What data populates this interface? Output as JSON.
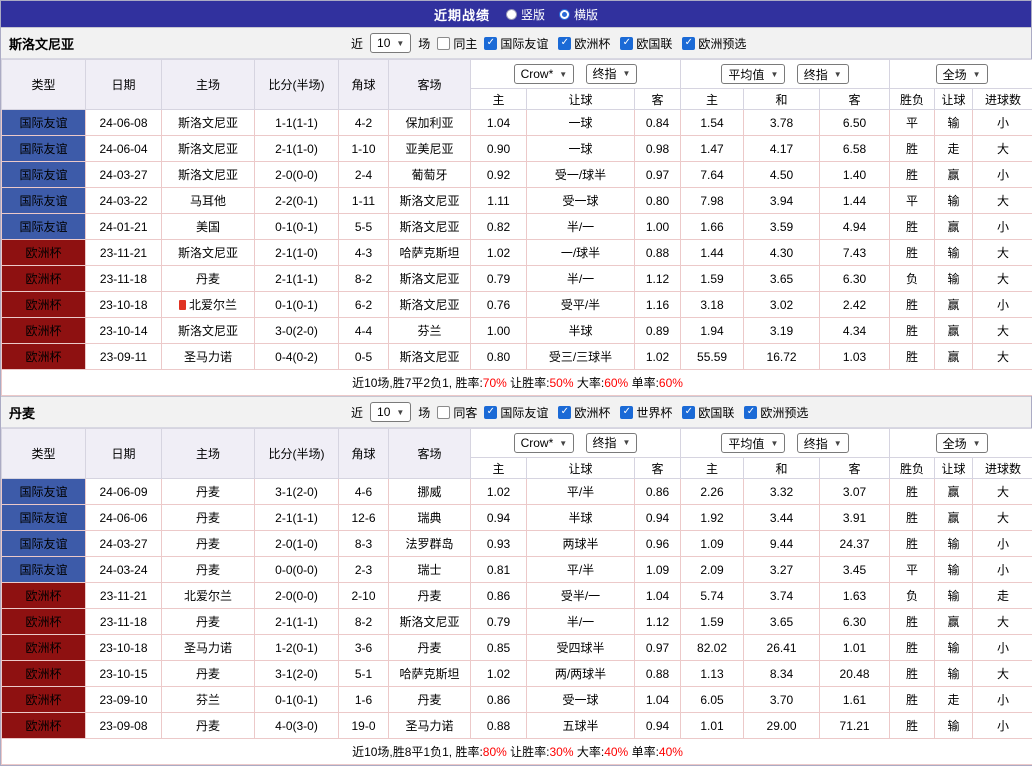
{
  "colors": {
    "topbar_bg": "#31319e",
    "type_blue": "#3d5ba9",
    "type_maroon": "#8e1111",
    "team_green": "#008000",
    "score_red": "#ff0000",
    "win_red": "#ff0000",
    "lose_green": "#008000",
    "loss_blue": "#0000cc",
    "grid_pink": "#ecc9c9",
    "checkbox_blue": "#1b6ad6"
  },
  "top_bar": {
    "title": "近期战绩",
    "radio_options": [
      {
        "label": "竖版",
        "selected": false
      },
      {
        "label": "横版",
        "selected": true
      }
    ]
  },
  "labels": {
    "near": "近",
    "games": "场"
  },
  "table_header": {
    "type": "类型",
    "date": "日期",
    "home": "主场",
    "score": "比分(半场)",
    "corners": "角球",
    "away": "客场",
    "odds_group1": {
      "select_a": "Crow*",
      "select_b": "终指",
      "sub": [
        "主",
        "让球",
        "客"
      ]
    },
    "odds_group2": {
      "select_a": "平均值",
      "select_b": "终指",
      "sub": [
        "主",
        "和",
        "客"
      ]
    },
    "result_group": {
      "select": "全场",
      "sub": [
        "胜负",
        "让球",
        "进球数"
      ]
    }
  },
  "sections": [
    {
      "team": "斯洛文尼亚",
      "filter": {
        "count": "10",
        "same_side_label": "同主",
        "same_side_checked": false,
        "competitions": [
          {
            "label": "国际友谊",
            "checked": true
          },
          {
            "label": "欧洲杯",
            "checked": true
          },
          {
            "label": "欧国联",
            "checked": true
          },
          {
            "label": "欧洲预选",
            "checked": true
          }
        ]
      },
      "rows": [
        {
          "type": "国际友谊",
          "type_color": "blue",
          "date": "24-06-08",
          "home": "斯洛文尼亚",
          "home_green": true,
          "home_icon": false,
          "score": "1-1(1-1)",
          "corners": "4-2",
          "away": "保加利亚",
          "away_green": false,
          "odds1": [
            "1.04",
            "一球",
            "0.84"
          ],
          "odds2": [
            "1.54",
            "3.78",
            "6.50"
          ],
          "result": [
            {
              "text": "平",
              "color": "green"
            },
            {
              "text": "输",
              "color": "green"
            },
            {
              "text": "小",
              "color": "green"
            }
          ]
        },
        {
          "type": "国际友谊",
          "type_color": "blue",
          "date": "24-06-04",
          "home": "斯洛文尼亚",
          "home_green": true,
          "home_icon": false,
          "score": "2-1(1-0)",
          "corners": "1-10",
          "away": "亚美尼亚",
          "away_green": false,
          "odds1": [
            "0.90",
            "一球",
            "0.98"
          ],
          "odds2": [
            "1.47",
            "4.17",
            "6.58"
          ],
          "result": [
            {
              "text": "胜",
              "color": "red"
            },
            {
              "text": "走",
              "color": "green"
            },
            {
              "text": "大",
              "color": "red"
            }
          ]
        },
        {
          "type": "国际友谊",
          "type_color": "blue",
          "date": "24-03-27",
          "home": "斯洛文尼亚",
          "home_green": true,
          "home_icon": false,
          "score": "2-0(0-0)",
          "corners": "2-4",
          "away": "葡萄牙",
          "away_green": false,
          "odds1": [
            "0.92",
            "受一/球半",
            "0.97"
          ],
          "odds2": [
            "7.64",
            "4.50",
            "1.40"
          ],
          "result": [
            {
              "text": "胜",
              "color": "red"
            },
            {
              "text": "赢",
              "color": "red"
            },
            {
              "text": "小",
              "color": "green"
            }
          ]
        },
        {
          "type": "国际友谊",
          "type_color": "blue",
          "date": "24-03-22",
          "home": "马耳他",
          "home_green": false,
          "home_icon": false,
          "score": "2-2(0-1)",
          "corners": "1-11",
          "away": "斯洛文尼亚",
          "away_green": true,
          "odds1": [
            "1.11",
            "受一球",
            "0.80"
          ],
          "odds2": [
            "7.98",
            "3.94",
            "1.44"
          ],
          "result": [
            {
              "text": "平",
              "color": "green"
            },
            {
              "text": "输",
              "color": "green"
            },
            {
              "text": "大",
              "color": "red"
            }
          ]
        },
        {
          "type": "国际友谊",
          "type_color": "blue",
          "date": "24-01-21",
          "home": "美国",
          "home_green": false,
          "home_icon": false,
          "score": "0-1(0-1)",
          "corners": "5-5",
          "away": "斯洛文尼亚",
          "away_green": true,
          "odds1": [
            "0.82",
            "半/一",
            "1.00"
          ],
          "odds2": [
            "1.66",
            "3.59",
            "4.94"
          ],
          "result": [
            {
              "text": "胜",
              "color": "red"
            },
            {
              "text": "赢",
              "color": "red"
            },
            {
              "text": "小",
              "color": "green"
            }
          ]
        },
        {
          "type": "欧洲杯",
          "type_color": "maroon",
          "date": "23-11-21",
          "home": "斯洛文尼亚",
          "home_green": true,
          "home_icon": false,
          "score": "2-1(1-0)",
          "corners": "4-3",
          "away": "哈萨克斯坦",
          "away_green": false,
          "odds1": [
            "1.02",
            "一/球半",
            "0.88"
          ],
          "odds2": [
            "1.44",
            "4.30",
            "7.43"
          ],
          "result": [
            {
              "text": "胜",
              "color": "red"
            },
            {
              "text": "输",
              "color": "green"
            },
            {
              "text": "大",
              "color": "red"
            }
          ]
        },
        {
          "type": "欧洲杯",
          "type_color": "maroon",
          "date": "23-11-18",
          "home": "丹麦",
          "home_green": false,
          "home_icon": false,
          "score": "2-1(1-1)",
          "corners": "8-2",
          "away": "斯洛文尼亚",
          "away_green": true,
          "odds1": [
            "0.79",
            "半/一",
            "1.12"
          ],
          "odds2": [
            "1.59",
            "3.65",
            "6.30"
          ],
          "result": [
            {
              "text": "负",
              "color": "blue"
            },
            {
              "text": "输",
              "color": "green"
            },
            {
              "text": "大",
              "color": "red"
            }
          ]
        },
        {
          "type": "欧洲杯",
          "type_color": "maroon",
          "date": "23-10-18",
          "home": "北爱尔兰",
          "home_green": false,
          "home_icon": true,
          "score": "0-1(0-1)",
          "corners": "6-2",
          "away": "斯洛文尼亚",
          "away_green": true,
          "odds1": [
            "0.76",
            "受平/半",
            "1.16"
          ],
          "odds2": [
            "3.18",
            "3.02",
            "2.42"
          ],
          "result": [
            {
              "text": "胜",
              "color": "red"
            },
            {
              "text": "赢",
              "color": "red"
            },
            {
              "text": "小",
              "color": "green"
            }
          ]
        },
        {
          "type": "欧洲杯",
          "type_color": "maroon",
          "date": "23-10-14",
          "home": "斯洛文尼亚",
          "home_green": true,
          "home_icon": false,
          "score": "3-0(2-0)",
          "corners": "4-4",
          "away": "芬兰",
          "away_green": false,
          "odds1": [
            "1.00",
            "半球",
            "0.89"
          ],
          "odds2": [
            "1.94",
            "3.19",
            "4.34"
          ],
          "result": [
            {
              "text": "胜",
              "color": "red"
            },
            {
              "text": "赢",
              "color": "red"
            },
            {
              "text": "大",
              "color": "red"
            }
          ]
        },
        {
          "type": "欧洲杯",
          "type_color": "maroon",
          "date": "23-09-11",
          "home": "圣马力诺",
          "home_green": false,
          "home_icon": false,
          "score": "0-4(0-2)",
          "corners": "0-5",
          "away": "斯洛文尼亚",
          "away_green": true,
          "odds1": [
            "0.80",
            "受三/三球半",
            "1.02"
          ],
          "odds2": [
            "55.59",
            "16.72",
            "1.03"
          ],
          "result": [
            {
              "text": "胜",
              "color": "red"
            },
            {
              "text": "赢",
              "color": "red"
            },
            {
              "text": "大",
              "color": "red"
            }
          ]
        }
      ],
      "summary": [
        {
          "text": "近10场,胜7平2负1, ",
          "red": false
        },
        {
          "text": "胜率:",
          "red": false
        },
        {
          "text": "70%",
          "red": true
        },
        {
          "text": " 让胜率:",
          "red": false
        },
        {
          "text": "50%",
          "red": true
        },
        {
          "text": " 大率:",
          "red": false
        },
        {
          "text": "60%",
          "red": true
        },
        {
          "text": " 单率:",
          "red": false
        },
        {
          "text": "60%",
          "red": true
        }
      ]
    },
    {
      "team": "丹麦",
      "filter": {
        "count": "10",
        "same_side_label": "同客",
        "same_side_checked": false,
        "competitions": [
          {
            "label": "国际友谊",
            "checked": true
          },
          {
            "label": "欧洲杯",
            "checked": true
          },
          {
            "label": "世界杯",
            "checked": true
          },
          {
            "label": "欧国联",
            "checked": true
          },
          {
            "label": "欧洲预选",
            "checked": true
          }
        ]
      },
      "rows": [
        {
          "type": "国际友谊",
          "type_color": "blue",
          "date": "24-06-09",
          "home": "丹麦",
          "home_green": true,
          "home_icon": false,
          "score": "3-1(2-0)",
          "corners": "4-6",
          "away": "挪威",
          "away_green": false,
          "odds1": [
            "1.02",
            "平/半",
            "0.86"
          ],
          "odds2": [
            "2.26",
            "3.32",
            "3.07"
          ],
          "result": [
            {
              "text": "胜",
              "color": "red"
            },
            {
              "text": "赢",
              "color": "red"
            },
            {
              "text": "大",
              "color": "red"
            }
          ]
        },
        {
          "type": "国际友谊",
          "type_color": "blue",
          "date": "24-06-06",
          "home": "丹麦",
          "home_green": true,
          "home_icon": false,
          "score": "2-1(1-1)",
          "corners": "12-6",
          "away": "瑞典",
          "away_green": false,
          "odds1": [
            "0.94",
            "半球",
            "0.94"
          ],
          "odds2": [
            "1.92",
            "3.44",
            "3.91"
          ],
          "result": [
            {
              "text": "胜",
              "color": "red"
            },
            {
              "text": "赢",
              "color": "red"
            },
            {
              "text": "大",
              "color": "red"
            }
          ]
        },
        {
          "type": "国际友谊",
          "type_color": "blue",
          "date": "24-03-27",
          "home": "丹麦",
          "home_green": true,
          "home_icon": false,
          "score": "2-0(1-0)",
          "corners": "8-3",
          "away": "法罗群岛",
          "away_green": false,
          "odds1": [
            "0.93",
            "两球半",
            "0.96"
          ],
          "odds2": [
            "1.09",
            "9.44",
            "24.37"
          ],
          "result": [
            {
              "text": "胜",
              "color": "red"
            },
            {
              "text": "输",
              "color": "green"
            },
            {
              "text": "小",
              "color": "green"
            }
          ]
        },
        {
          "type": "国际友谊",
          "type_color": "blue",
          "date": "24-03-24",
          "home": "丹麦",
          "home_green": true,
          "home_icon": false,
          "score": "0-0(0-0)",
          "corners": "2-3",
          "away": "瑞士",
          "away_green": false,
          "odds1": [
            "0.81",
            "平/半",
            "1.09"
          ],
          "odds2": [
            "2.09",
            "3.27",
            "3.45"
          ],
          "result": [
            {
              "text": "平",
              "color": "green"
            },
            {
              "text": "输",
              "color": "green"
            },
            {
              "text": "小",
              "color": "green"
            }
          ]
        },
        {
          "type": "欧洲杯",
          "type_color": "maroon",
          "date": "23-11-21",
          "home": "北爱尔兰",
          "home_green": false,
          "home_icon": false,
          "score": "2-0(0-0)",
          "corners": "2-10",
          "away": "丹麦",
          "away_green": true,
          "odds1": [
            "0.86",
            "受半/一",
            "1.04"
          ],
          "odds2": [
            "5.74",
            "3.74",
            "1.63"
          ],
          "result": [
            {
              "text": "负",
              "color": "blue"
            },
            {
              "text": "输",
              "color": "green"
            },
            {
              "text": "走",
              "color": "green"
            }
          ]
        },
        {
          "type": "欧洲杯",
          "type_color": "maroon",
          "date": "23-11-18",
          "home": "丹麦",
          "home_green": true,
          "home_icon": false,
          "score": "2-1(1-1)",
          "corners": "8-2",
          "away": "斯洛文尼亚",
          "away_green": false,
          "odds1": [
            "0.79",
            "半/一",
            "1.12"
          ],
          "odds2": [
            "1.59",
            "3.65",
            "6.30"
          ],
          "result": [
            {
              "text": "胜",
              "color": "red"
            },
            {
              "text": "赢",
              "color": "red"
            },
            {
              "text": "大",
              "color": "red"
            }
          ]
        },
        {
          "type": "欧洲杯",
          "type_color": "maroon",
          "date": "23-10-18",
          "home": "圣马力诺",
          "home_green": false,
          "home_icon": false,
          "score": "1-2(0-1)",
          "corners": "3-6",
          "away": "丹麦",
          "away_green": true,
          "odds1": [
            "0.85",
            "受四球半",
            "0.97"
          ],
          "odds2": [
            "82.02",
            "26.41",
            "1.01"
          ],
          "result": [
            {
              "text": "胜",
              "color": "red"
            },
            {
              "text": "输",
              "color": "green"
            },
            {
              "text": "小",
              "color": "green"
            }
          ]
        },
        {
          "type": "欧洲杯",
          "type_color": "maroon",
          "date": "23-10-15",
          "home": "丹麦",
          "home_green": true,
          "home_icon": false,
          "score": "3-1(2-0)",
          "corners": "5-1",
          "away": "哈萨克斯坦",
          "away_green": false,
          "odds1": [
            "1.02",
            "两/两球半",
            "0.88"
          ],
          "odds2": [
            "1.13",
            "8.34",
            "20.48"
          ],
          "result": [
            {
              "text": "胜",
              "color": "red"
            },
            {
              "text": "输",
              "color": "green"
            },
            {
              "text": "大",
              "color": "red"
            }
          ]
        },
        {
          "type": "欧洲杯",
          "type_color": "maroon",
          "date": "23-09-10",
          "home": "芬兰",
          "home_green": false,
          "home_icon": false,
          "score": "0-1(0-1)",
          "corners": "1-6",
          "away": "丹麦",
          "away_green": true,
          "odds1": [
            "0.86",
            "受一球",
            "1.04"
          ],
          "odds2": [
            "6.05",
            "3.70",
            "1.61"
          ],
          "result": [
            {
              "text": "胜",
              "color": "red"
            },
            {
              "text": "走",
              "color": "green"
            },
            {
              "text": "小",
              "color": "green"
            }
          ]
        },
        {
          "type": "欧洲杯",
          "type_color": "maroon",
          "date": "23-09-08",
          "home": "丹麦",
          "home_green": true,
          "home_icon": false,
          "score": "4-0(3-0)",
          "corners": "19-0",
          "away": "圣马力诺",
          "away_green": false,
          "odds1": [
            "0.88",
            "五球半",
            "0.94"
          ],
          "odds2": [
            "1.01",
            "29.00",
            "71.21"
          ],
          "result": [
            {
              "text": "胜",
              "color": "red"
            },
            {
              "text": "输",
              "color": "green"
            },
            {
              "text": "小",
              "color": "green"
            }
          ]
        }
      ],
      "summary": [
        {
          "text": "近10场,胜8平1负1, ",
          "red": false
        },
        {
          "text": "胜率:",
          "red": false
        },
        {
          "text": "80%",
          "red": true
        },
        {
          "text": " 让胜率:",
          "red": false
        },
        {
          "text": "30%",
          "red": true
        },
        {
          "text": " 大率:",
          "red": false
        },
        {
          "text": "40%",
          "red": true
        },
        {
          "text": " 单率:",
          "red": false
        },
        {
          "text": "40%",
          "red": true
        }
      ]
    }
  ]
}
